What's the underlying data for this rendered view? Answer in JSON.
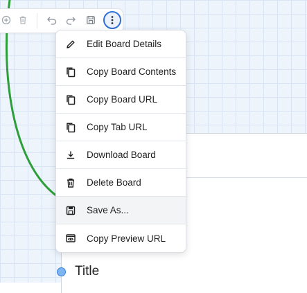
{
  "card": {
    "title": "Title"
  },
  "toolbar": {
    "buttons": [
      {
        "icon": "add-circle-icon"
      },
      {
        "icon": "trash-icon"
      },
      {
        "icon": "undo-icon"
      },
      {
        "icon": "redo-icon"
      },
      {
        "icon": "save-icon"
      },
      {
        "icon": "more-vertical-icon"
      }
    ]
  },
  "menu": {
    "items": [
      {
        "label": "Edit Board Details",
        "icon": "pencil-icon"
      },
      {
        "label": "Copy Board Contents",
        "icon": "copy-icon"
      },
      {
        "label": "Copy Board URL",
        "icon": "copy-icon"
      },
      {
        "label": "Copy Tab URL",
        "icon": "copy-icon"
      },
      {
        "label": "Download Board",
        "icon": "download-icon"
      },
      {
        "label": "Delete Board",
        "icon": "trash-icon"
      },
      {
        "label": "Save As...",
        "icon": "save-icon"
      },
      {
        "label": "Copy Preview URL",
        "icon": "preview-icon"
      }
    ],
    "hovered_index": 6
  },
  "colors": {
    "accent": "#2f6fd6",
    "connector": "#2e9e3a",
    "handle": "#7db5f2"
  }
}
